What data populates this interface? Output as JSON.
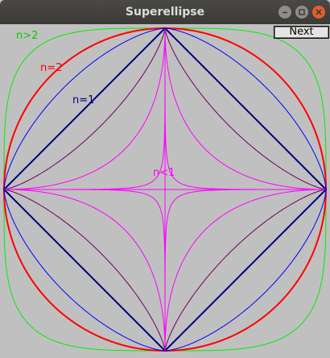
{
  "window": {
    "title": "Superellipse",
    "controls": [
      "minimize-icon",
      "maximize-icon",
      "close-icon"
    ]
  },
  "toolbar": {
    "next_label": "Next"
  },
  "labels": [
    {
      "key": "n_gt_2",
      "text": "n>2",
      "color": "#00cc00"
    },
    {
      "key": "n_eq_2",
      "text": "n=2",
      "color": "#ff0000"
    },
    {
      "key": "n_eq_1",
      "text": "n=1",
      "color": "#000080"
    },
    {
      "key": "n_lt_1",
      "text": "n<1",
      "color": "#ff00ff"
    }
  ],
  "curves": [
    {
      "n": 4,
      "color": "#00ee00",
      "meaning": "n>2"
    },
    {
      "n": 2,
      "color": "#ff0000",
      "meaning": "n=2"
    },
    {
      "n": 1.5,
      "color": "#0000ff"
    },
    {
      "n": 1,
      "color": "#000080",
      "meaning": "n=1"
    },
    {
      "n": 0.75,
      "color": "#6a0060"
    },
    {
      "n": 0.5,
      "color": "#ff00ff",
      "meaning": "n<1"
    },
    {
      "n": 0.25,
      "color": "#ff00ff"
    }
  ],
  "axis_color": "#ff00ff"
}
